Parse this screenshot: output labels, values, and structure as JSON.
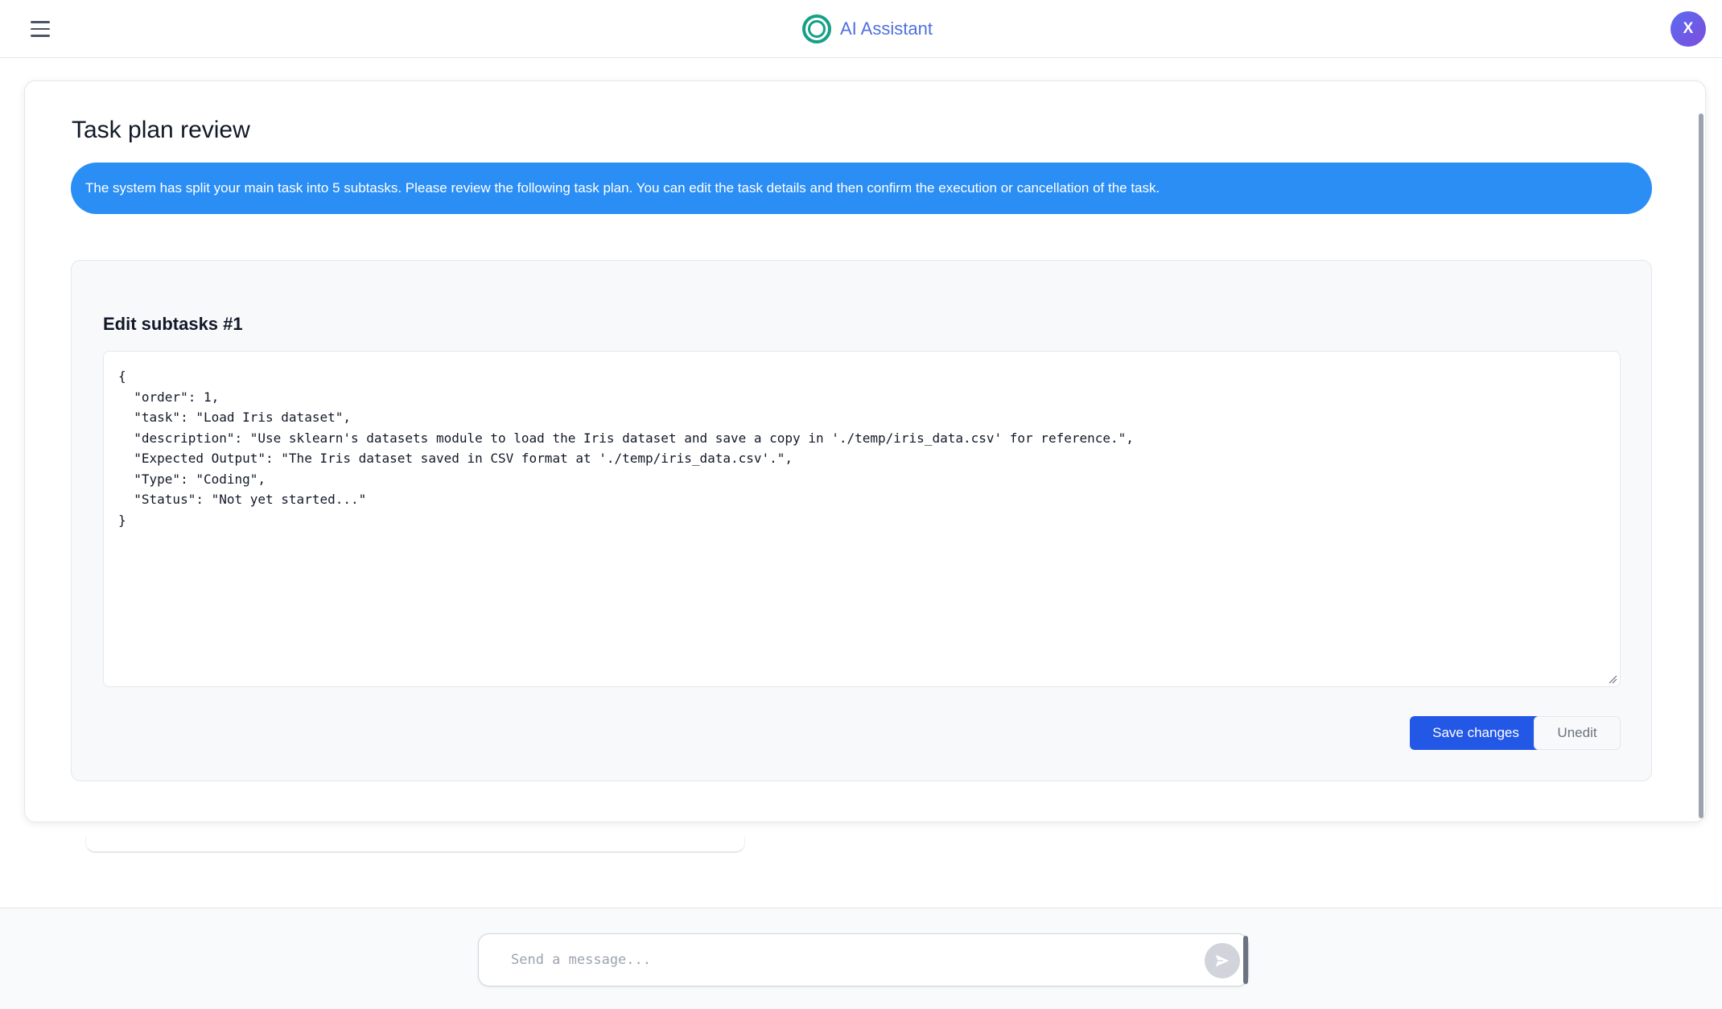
{
  "header": {
    "app_name": "AI Assistant",
    "avatar_initial": "X",
    "brand_color": "#16a085",
    "accent_color": "#4f6fe0"
  },
  "review": {
    "title": "Task plan review",
    "banner": "The system has split your main task into 5 subtasks. Please review the following task plan. You can edit the task details and then confirm the execution or cancellation of the task."
  },
  "editor": {
    "title": "Edit subtasks #1",
    "content": "{\n  \"order\": 1,\n  \"task\": \"Load Iris dataset\",\n  \"description\": \"Use sklearn's datasets module to load the Iris dataset and save a copy in './temp/iris_data.csv' for reference.\",\n  \"Expected Output\": \"The Iris dataset saved in CSV format at './temp/iris_data.csv'.\",\n  \"Type\": \"Coding\",\n  \"Status\": \"Not yet started...\"\n}",
    "save_label": "Save changes",
    "unedit_label": "Unedit"
  },
  "composer": {
    "placeholder": "Send a message..."
  },
  "icons": {
    "menu": "hamburger-menu-icon",
    "logo": "ring-logo-icon",
    "send": "send-arrow-icon"
  }
}
